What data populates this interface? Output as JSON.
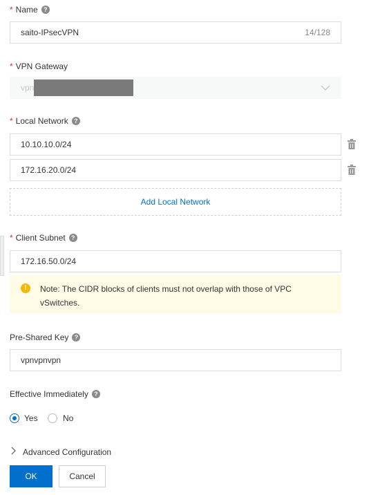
{
  "form": {
    "name": {
      "label": "Name",
      "value": "saito-IPsecVPN",
      "counter": "14/128"
    },
    "vpn_gateway": {
      "label": "VPN Gateway",
      "value": "vpn"
    },
    "local_network": {
      "label": "Local Network",
      "entries": [
        "10.10.10.0/24",
        "172.16.20.0/24"
      ],
      "add_label": "Add Local Network"
    },
    "client_subnet": {
      "label": "Client Subnet",
      "value": "172.16.50.0/24",
      "note": "Note: The CIDR blocks of clients must not overlap with those of VPC vSwitches."
    },
    "pre_shared_key": {
      "label": "Pre-Shared Key",
      "value": "vpnvpnvpn"
    },
    "effective_immediately": {
      "label": "Effective Immediately",
      "options": [
        "Yes",
        "No"
      ],
      "selected": "Yes"
    },
    "advanced": {
      "label": "Advanced Configuration"
    },
    "actions": {
      "ok": "OK",
      "cancel": "Cancel"
    }
  },
  "colors": {
    "primary": "#0070cc",
    "required": "#d93026",
    "note_bg": "#fffbe6",
    "warning": "#f5b800"
  }
}
